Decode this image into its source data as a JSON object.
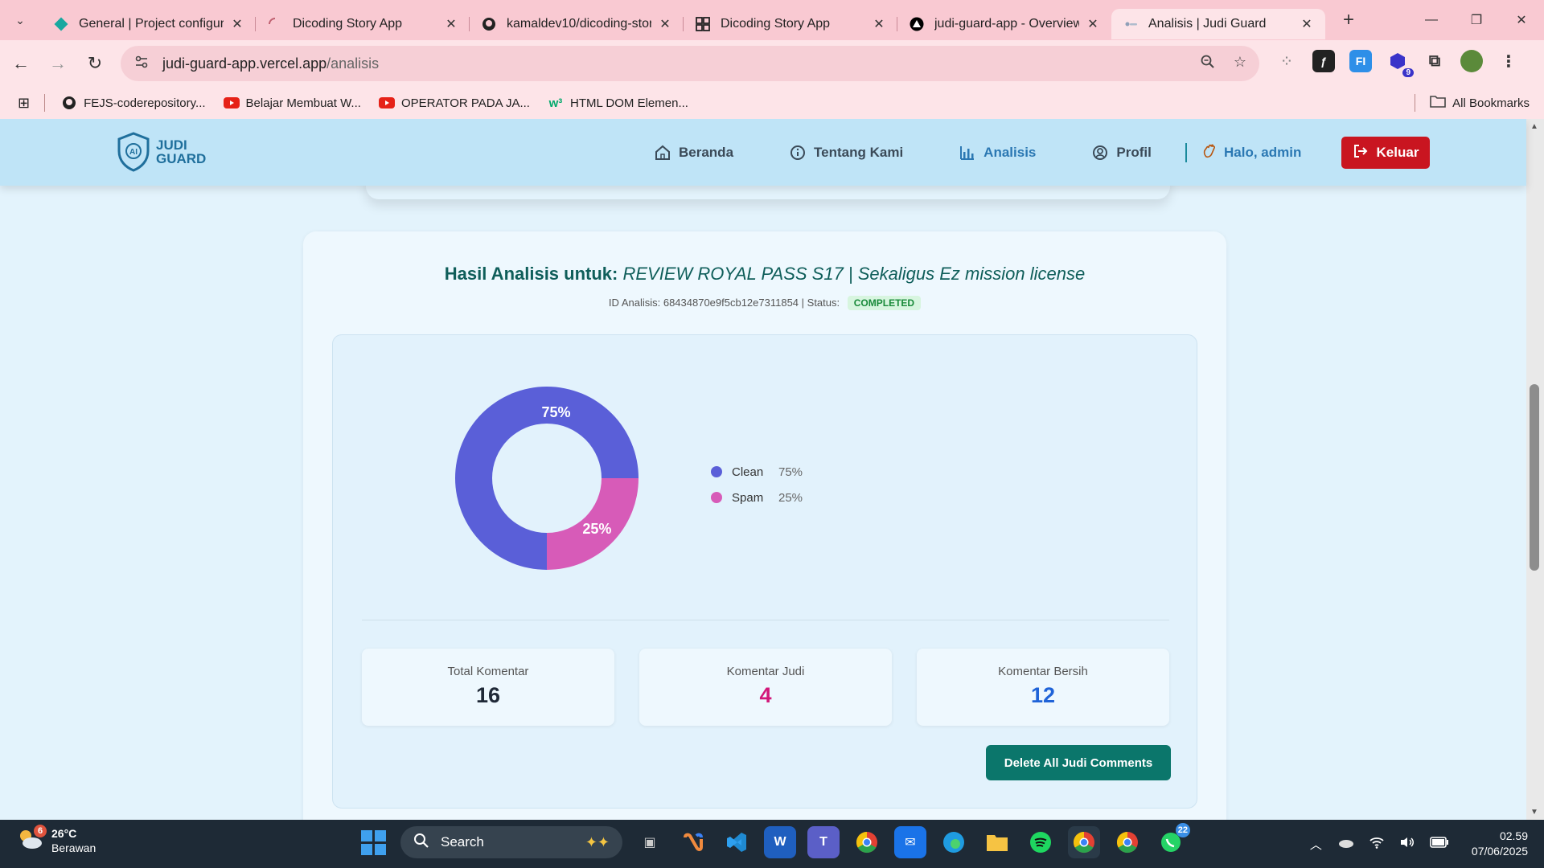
{
  "browser": {
    "tabs": [
      {
        "title": "General | Project configura",
        "icon": "diamond-icon",
        "color": "#18a8a0"
      },
      {
        "title": "Dicoding Story App",
        "icon": "loading-icon",
        "color": "#c06070"
      },
      {
        "title": "kamaldev10/dicoding-stor",
        "icon": "github-icon",
        "color": "#222222"
      },
      {
        "title": "Dicoding Story App",
        "icon": "grid-icon",
        "color": "#222222"
      },
      {
        "title": "judi-guard-app - Overview",
        "icon": "vercel-icon",
        "color": "#000000"
      },
      {
        "title": "Analisis | Judi Guard",
        "icon": "page-icon",
        "color": "#90a0b8",
        "active": true
      }
    ],
    "url_host": "judi-guard-app.vercel.app",
    "url_path": "/analisis",
    "bookmarks": [
      {
        "label": "FEJS-coderepository...",
        "icon": "github-icon"
      },
      {
        "label": "Belajar Membuat W...",
        "icon": "youtube-icon"
      },
      {
        "label": "OPERATOR PADA JA...",
        "icon": "youtube-icon"
      },
      {
        "label": "HTML DOM Elemen...",
        "icon": "w3schools-icon"
      }
    ],
    "all_bookmarks": "All Bookmarks",
    "ext_badge": "9"
  },
  "app": {
    "logo_line1": "JUDI",
    "logo_line2": "GUARD",
    "menu": [
      {
        "label": "Beranda",
        "icon": "home-icon"
      },
      {
        "label": "Tentang Kami",
        "icon": "info-icon"
      },
      {
        "label": "Analisis",
        "icon": "chart-icon",
        "active": true
      },
      {
        "label": "Profil",
        "icon": "user-icon"
      }
    ],
    "greeting": "Halo, admin",
    "logout": "Keluar"
  },
  "result": {
    "title_prefix": "Hasil Analisis untuk:",
    "video_title": "REVIEW ROYAL PASS S17 | Sekaligus Ez mission license",
    "id_label": "ID Analisis: 68434870e9f5cb12e7311854 | Status:",
    "status": "COMPLETED",
    "stats": [
      {
        "label": "Total Komentar",
        "value": "16",
        "color": "#1f2937"
      },
      {
        "label": "Komentar Judi",
        "value": "4",
        "color": "#d2177a"
      },
      {
        "label": "Komentar Bersih",
        "value": "12",
        "color": "#1f63d8"
      }
    ],
    "delete_button": "Delete All Judi Comments"
  },
  "chart_data": {
    "type": "pie",
    "categories": [
      "Clean",
      "Spam"
    ],
    "values": [
      75,
      25
    ],
    "labels": [
      "75%",
      "25%"
    ],
    "colors": [
      "#5a5fd8",
      "#d75bb8"
    ],
    "legend": "right"
  },
  "taskbar": {
    "weather_badge": "6",
    "temperature": "26°C",
    "condition": "Berawan",
    "search": "Search",
    "time": "02.59",
    "date": "07/06/2025",
    "whatsapp_badge": "22"
  }
}
